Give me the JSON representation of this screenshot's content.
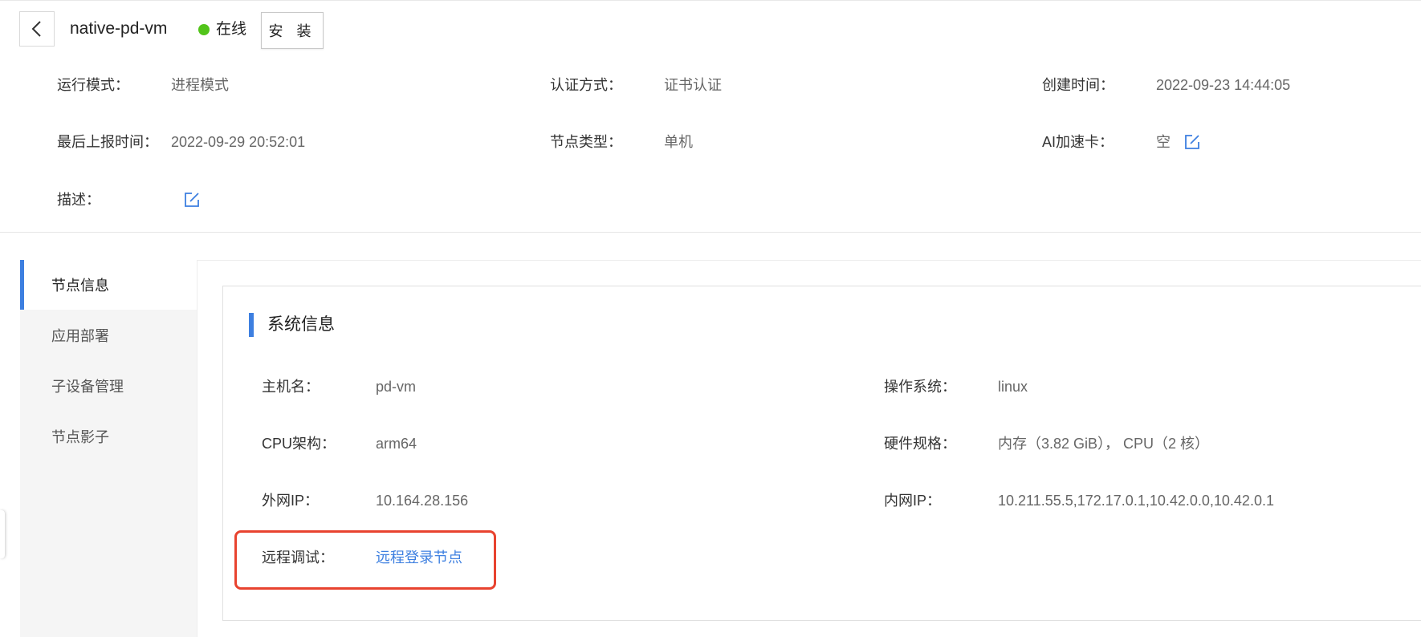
{
  "header": {
    "node_name": "native-pd-vm",
    "status": "在线",
    "install_label": "安 装",
    "status_color": "#52c41a"
  },
  "info": {
    "run_mode_label": "运行模式：",
    "run_mode_value": "进程模式",
    "auth_label": "认证方式：",
    "auth_value": "证书认证",
    "created_label": "创建时间：",
    "created_value": "2022-09-23 14:44:05",
    "last_report_label": "最后上报时间：",
    "last_report_value": "2022-09-29 20:52:01",
    "node_type_label": "节点类型：",
    "node_type_value": "单机",
    "ai_card_label": "AI加速卡：",
    "ai_card_value": "空",
    "desc_label": "描述："
  },
  "nav": {
    "items": [
      {
        "label": "节点信息",
        "active": true
      },
      {
        "label": "应用部署"
      },
      {
        "label": "子设备管理"
      },
      {
        "label": "节点影子"
      }
    ]
  },
  "system": {
    "title": "系统信息",
    "hostname_label": "主机名：",
    "hostname_value": "pd-vm",
    "os_label": "操作系统：",
    "os_value": "linux",
    "cpu_arch_label": "CPU架构：",
    "cpu_arch_value": "arm64",
    "hw_label": "硬件规格：",
    "hw_value": "内存（3.82 GiB）， CPU（2 核）",
    "public_ip_label": "外网IP：",
    "public_ip_value": "10.164.28.156",
    "private_ip_label": "内网IP：",
    "private_ip_value": "10.211.55.5,172.17.0.1,10.42.0.0,10.42.0.1",
    "remote_debug_label": "远程调试：",
    "remote_login_link": "远程登录节点"
  },
  "colors": {
    "accent": "#3d7fe0",
    "highlight": "#e8432f"
  },
  "icons": {
    "back": "chevron-left-icon",
    "edit": "edit-icon",
    "status": "status-dot"
  }
}
